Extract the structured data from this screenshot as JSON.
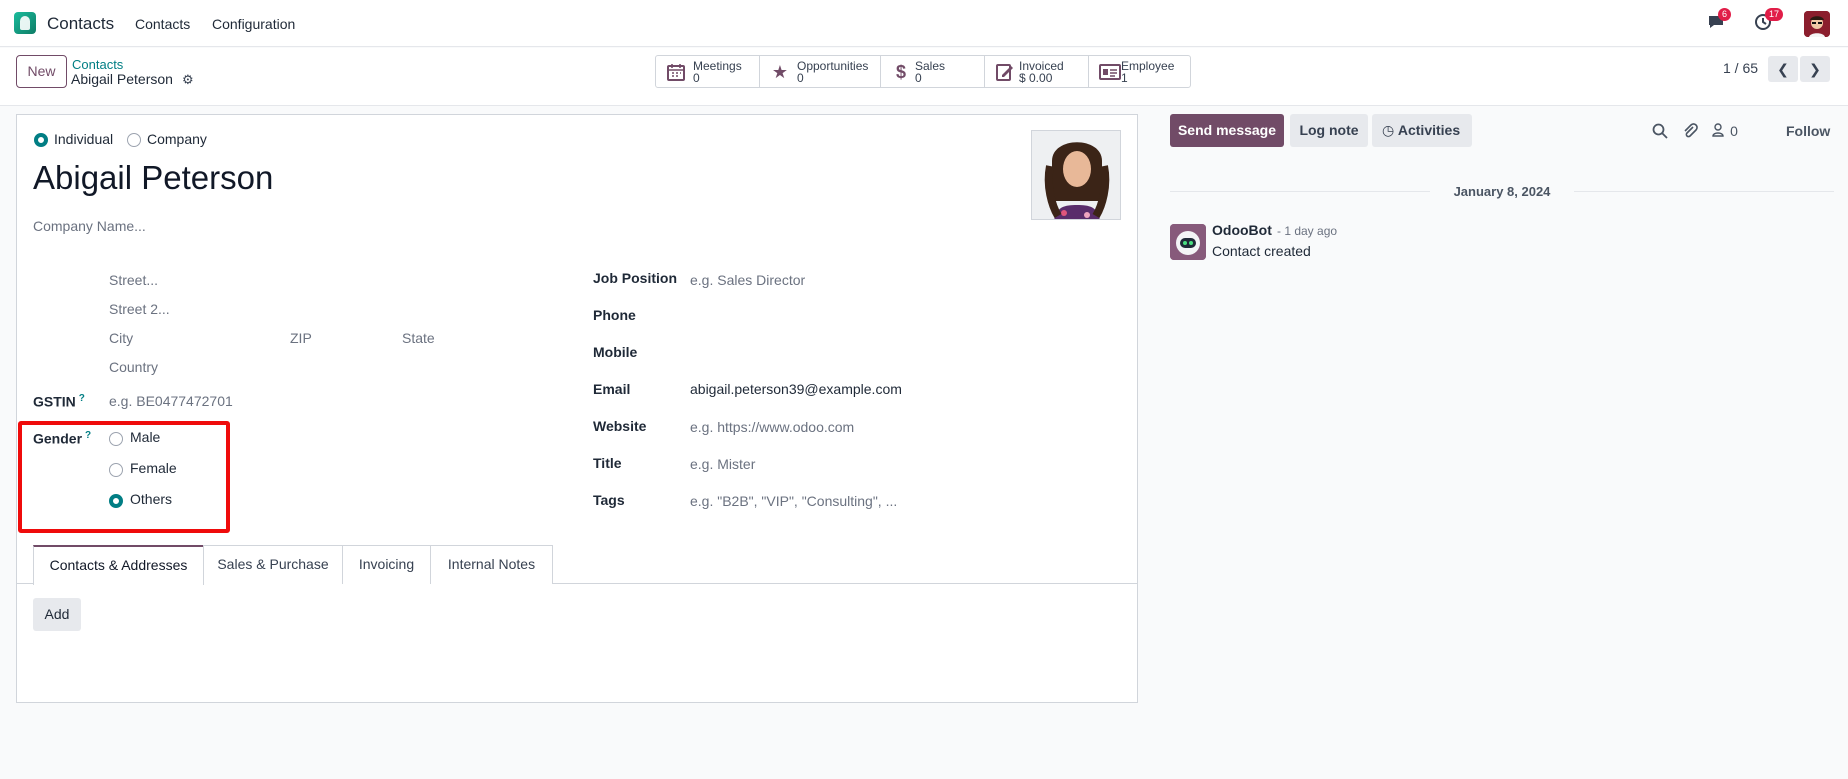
{
  "topbar": {
    "app_name": "Contacts",
    "menu": [
      "Contacts",
      "Configuration"
    ],
    "messages_badge": "6",
    "activities_badge": "17"
  },
  "control_panel": {
    "new_label": "New",
    "breadcrumb_parent": "Contacts",
    "breadcrumb_current": "Abigail Peterson",
    "smart_buttons": [
      {
        "label": "Meetings",
        "value": "0",
        "icon": "calendar-icon"
      },
      {
        "label": "Opportunities",
        "value": "0",
        "icon": "star-icon"
      },
      {
        "label": "Sales",
        "value": "0",
        "icon": "dollar-icon"
      },
      {
        "label": "Invoiced",
        "value": "$ 0.00",
        "icon": "invoice-icon"
      },
      {
        "label": "Employee",
        "value": "1",
        "icon": "id-card-icon"
      }
    ],
    "pager": "1 / 65"
  },
  "form": {
    "type_individual": "Individual",
    "type_company": "Company",
    "name": "Abigail Peterson",
    "company_placeholder": "Company Name...",
    "street_placeholder": "Street...",
    "street2_placeholder": "Street 2...",
    "city_placeholder": "City",
    "zip_placeholder": "ZIP",
    "state_placeholder": "State",
    "country_placeholder": "Country",
    "gstin_label": "GSTIN",
    "gstin_placeholder": "e.g. BE0477472701",
    "gender_label": "Gender",
    "gender_options": [
      "Male",
      "Female",
      "Others"
    ],
    "gender_selected": "Others",
    "help_mark": "?",
    "job_position_label": "Job Position",
    "job_position_placeholder": "e.g. Sales Director",
    "phone_label": "Phone",
    "mobile_label": "Mobile",
    "email_label": "Email",
    "email_value": "abigail.peterson39@example.com",
    "website_label": "Website",
    "website_placeholder": "e.g. https://www.odoo.com",
    "title_label": "Title",
    "title_placeholder": "e.g. Mister",
    "tags_label": "Tags",
    "tags_placeholder": "e.g. \"B2B\", \"VIP\", \"Consulting\", ...",
    "tabs": [
      "Contacts & Addresses",
      "Sales & Purchase",
      "Invoicing",
      "Internal Notes"
    ],
    "add_label": "Add"
  },
  "chatter": {
    "send_message": "Send message",
    "log_note": "Log note",
    "activities": "Activities",
    "followers_count": "0",
    "follow": "Follow",
    "date": "January 8, 2024",
    "message_author": "OdooBot",
    "message_time": "- 1 day ago",
    "message_body": "Contact created"
  },
  "colors": {
    "brand": "#714b67",
    "accent": "#017e84",
    "highlight": "#ef0b0b"
  }
}
